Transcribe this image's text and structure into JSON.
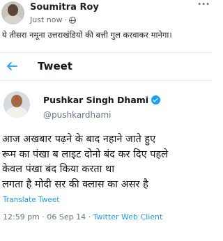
{
  "facebook_post": {
    "author_name": "Soumitra Roy",
    "timestamp": "Just now",
    "separator": "·",
    "more_icon": "ellipsis-icon",
    "caption": "ये तीसरा नमूना उत्तराखंडियों की बत्ती गुल करवाकर मानेगा।"
  },
  "tweet": {
    "header_title": "Tweet",
    "back_icon": "arrow-left-icon",
    "author_name": "Pushkar Singh Dhami",
    "handle": "@pushkardhami",
    "verified": true,
    "text_lines": [
      "आज  अखबार पढ़ने के बाद नहाने जाते हुए",
      "रूम का पंखा ब लाइट दोनो बंद कर दिए  पहले",
      "केवल पंखा बंद किया करता था",
      "लगता है मोदी सर की क्लास का असर है"
    ],
    "translate_label": "Translate Tweet",
    "time": "12:59 pm",
    "date": "06 Sep 14",
    "client": "Twitter Web Client",
    "accent_color": "#1da1f2"
  }
}
